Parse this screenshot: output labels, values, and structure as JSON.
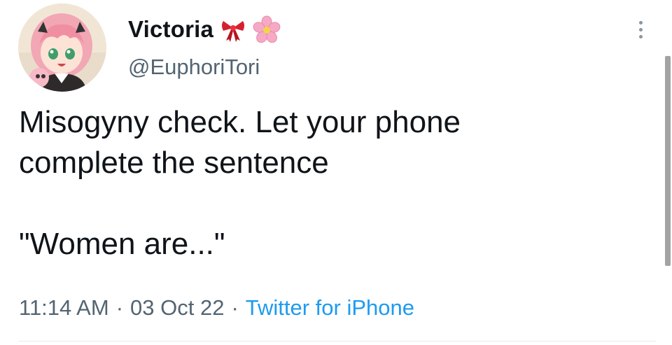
{
  "tweet": {
    "author": {
      "display_name": "Victoria",
      "handle": "@EuphoriTori",
      "name_emojis": [
        "ribbon-emoji",
        "cherry-blossom-emoji"
      ]
    },
    "text_lines": [
      "Misogyny check. Let your phone",
      "complete the sentence",
      "\"Women are...\""
    ],
    "timestamp": {
      "time": "11:14 AM",
      "date": "03 Oct 22",
      "separator": "·",
      "source": "Twitter for iPhone"
    }
  },
  "colors": {
    "text_primary": "#0f1419",
    "text_secondary": "#536471",
    "link": "#1d9bf0",
    "ribbon": "#d6202f",
    "blossom": "#f6a9c4"
  }
}
